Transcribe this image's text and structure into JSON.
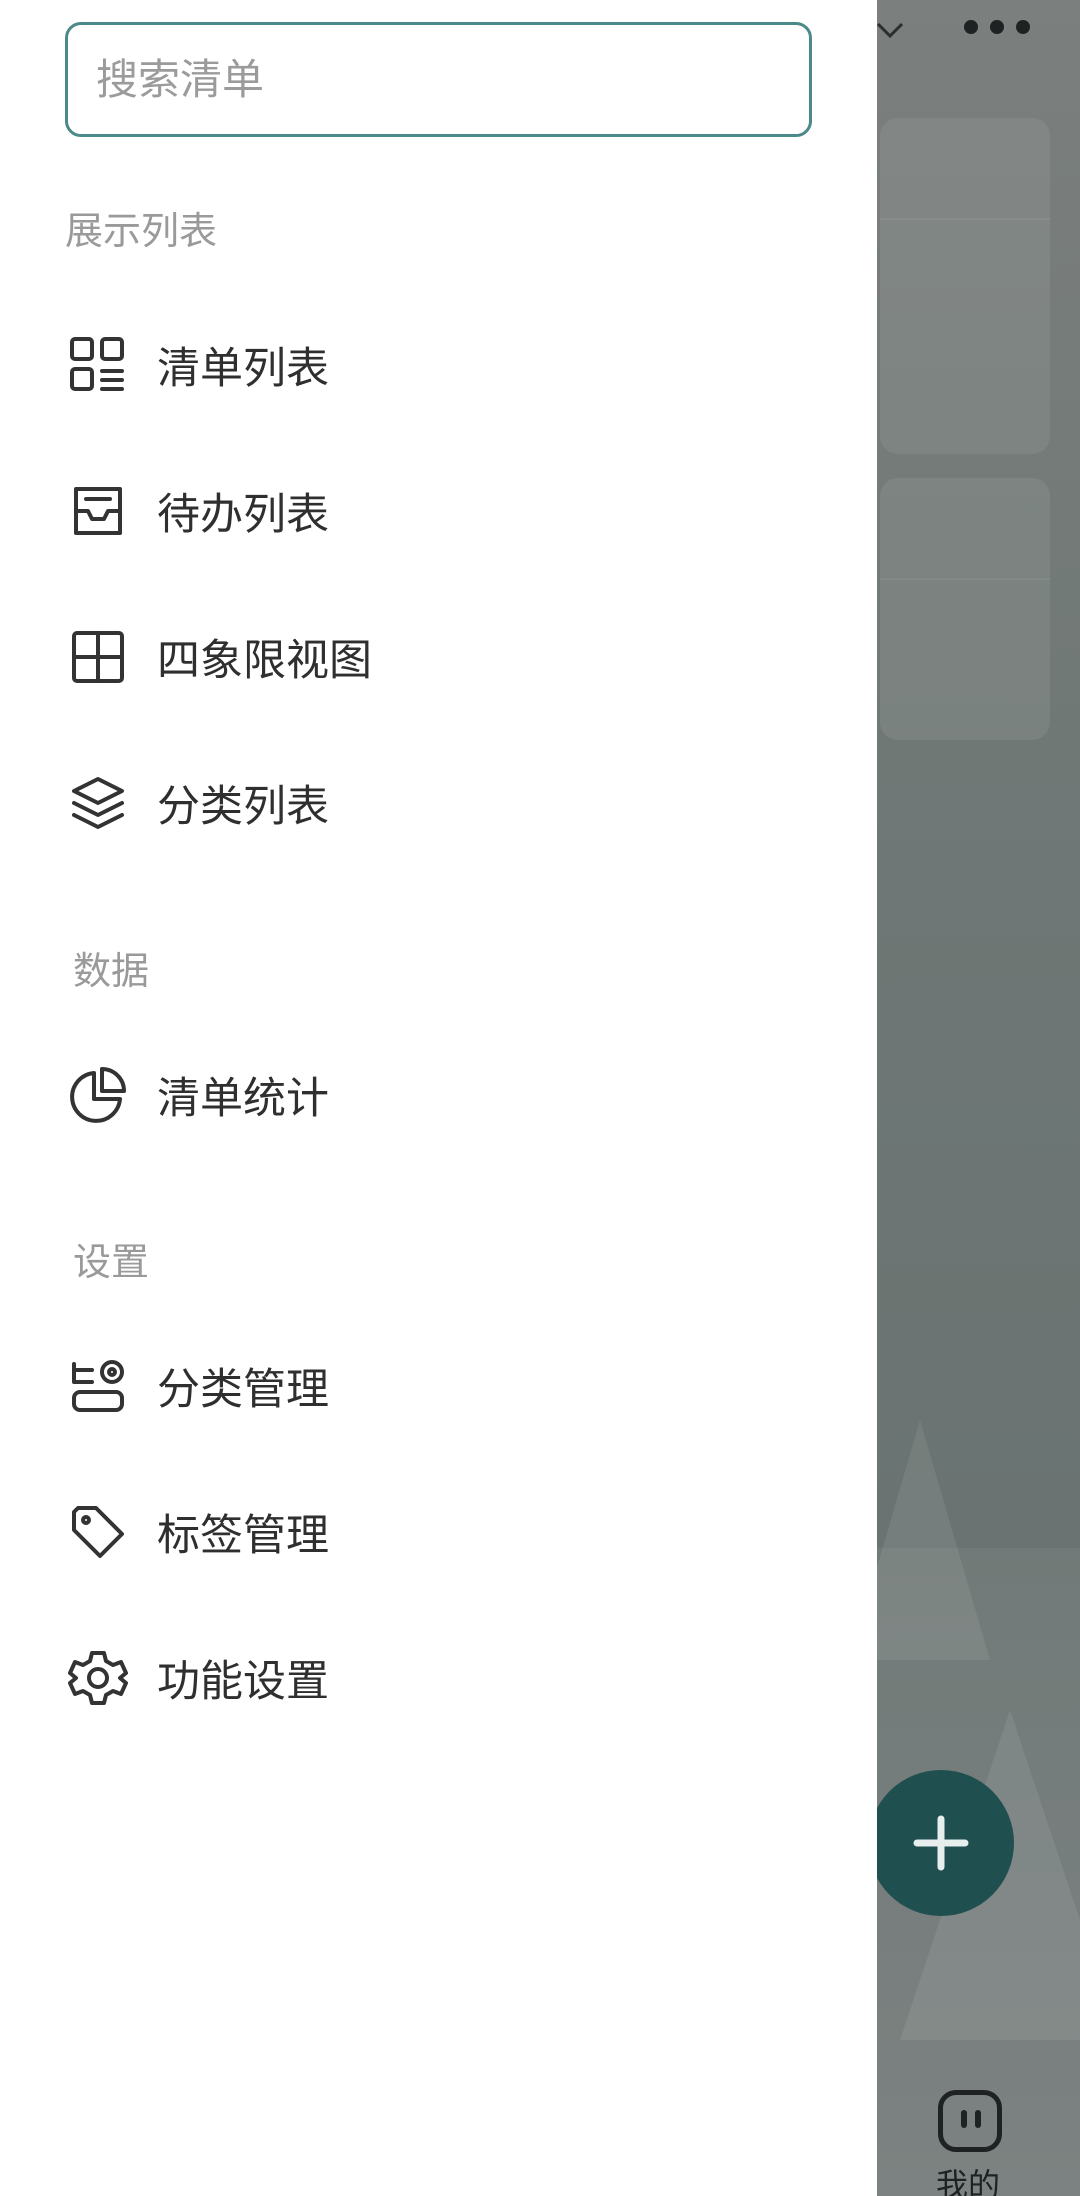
{
  "search": {
    "placeholder": "搜索清单"
  },
  "sections": {
    "display": "展示列表",
    "data": "数据",
    "settings": "设置"
  },
  "display_items": [
    {
      "label": "清单列表",
      "icon": "grid-list-icon"
    },
    {
      "label": "待办列表",
      "icon": "inbox-icon"
    },
    {
      "label": "四象限视图",
      "icon": "quadrant-icon"
    },
    {
      "label": "分类列表",
      "icon": "layers-icon"
    }
  ],
  "data_items": [
    {
      "label": "清单统计",
      "icon": "pie-chart-icon"
    }
  ],
  "settings_items": [
    {
      "label": "分类管理",
      "icon": "category-manage-icon"
    },
    {
      "label": "标签管理",
      "icon": "tag-icon"
    },
    {
      "label": "功能设置",
      "icon": "gear-icon"
    }
  ],
  "background": {
    "bottom_nav_label": "我的",
    "fab_icon": "plus-icon",
    "accent_color": "#1f4f4f",
    "border_color": "#4c8a8a"
  }
}
